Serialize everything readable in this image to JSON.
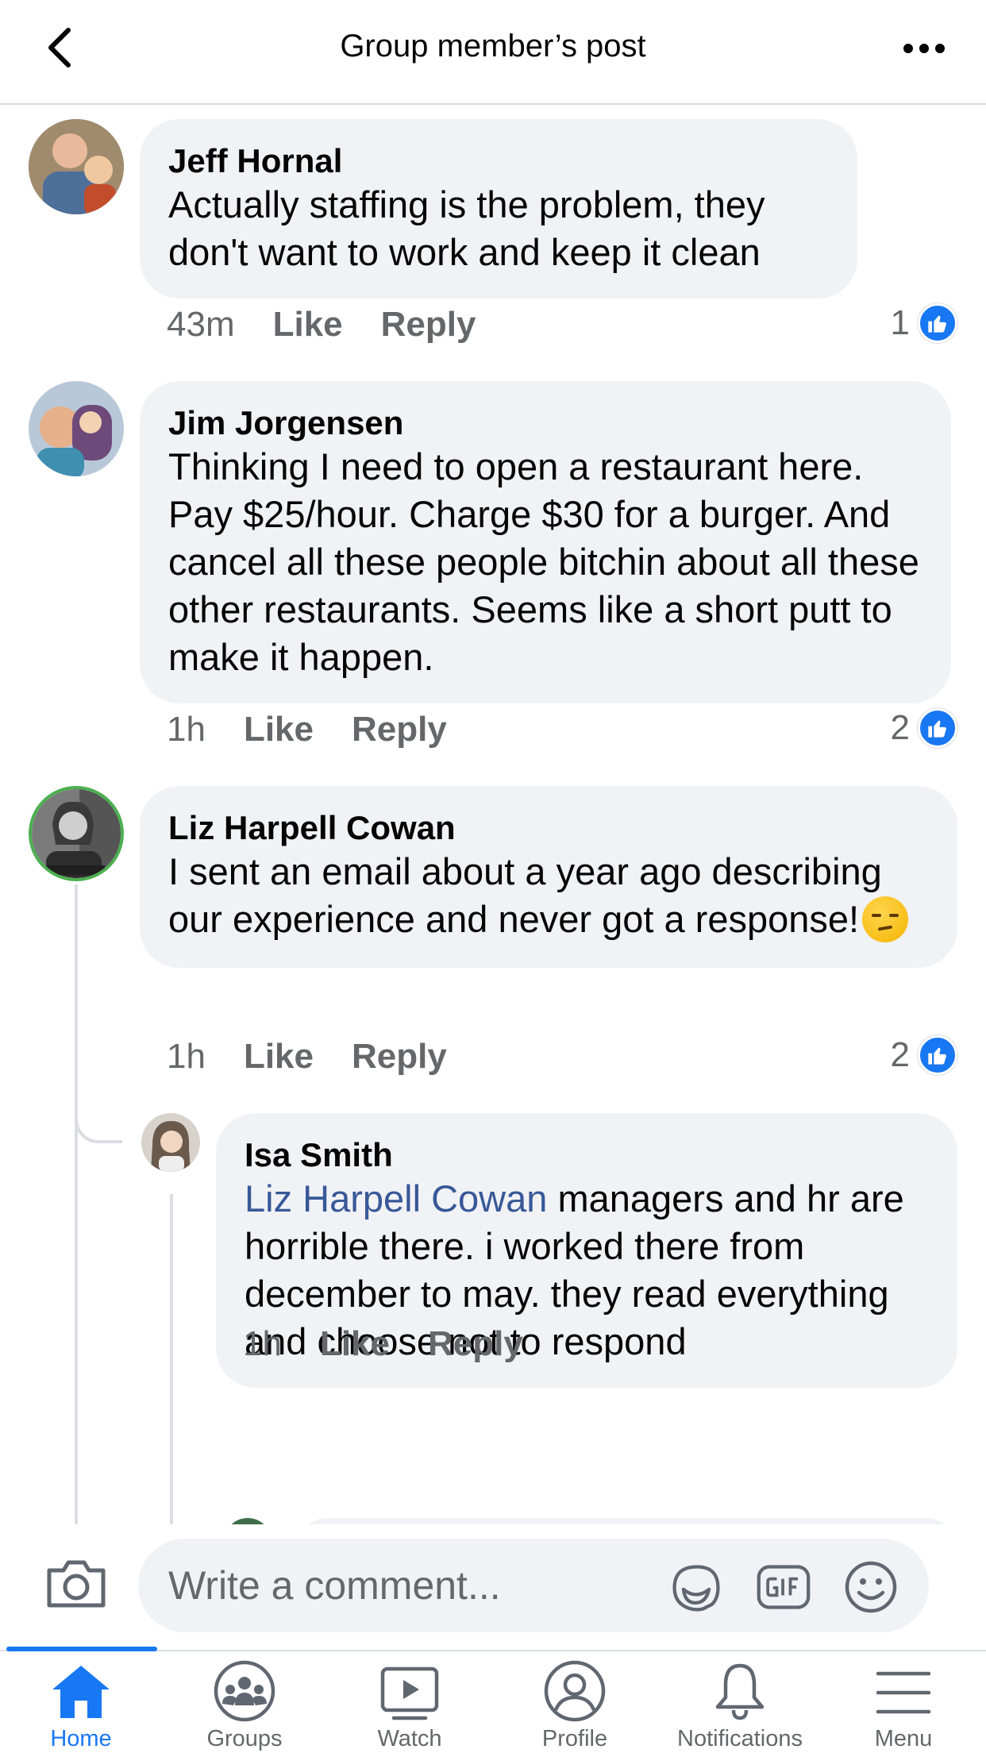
{
  "header": {
    "title": "Group member’s post"
  },
  "comments": [
    {
      "author": "Jeff Hornal",
      "text": "Actually staffing is the problem, they don't want to work and keep it clean",
      "time": "43m",
      "like_label": "Like",
      "reply_label": "Reply",
      "reaction_count": "1"
    },
    {
      "author": "Jim Jorgensen",
      "text": "Thinking I need to open a restaurant here. Pay $25/hour.   Charge $30 for a burger.  And cancel all these people bitchin about all these other restaurants.   Seems like a short putt to make it happen.",
      "time": "1h",
      "like_label": "Like",
      "reply_label": "Reply",
      "reaction_count": "2"
    },
    {
      "author": "Liz Harpell Cowan",
      "text": "I sent an email about a year ago describing our experience and never got a response!",
      "emoji": "unamused-face",
      "time": "1h",
      "like_label": "Like",
      "reply_label": "Reply",
      "reaction_count": "2",
      "replies": [
        {
          "author": "Isa Smith",
          "mention": "Liz Harpell Cowan",
          "text": " managers and hr are horrible there. i worked there from december to may. they read everything and choose not to respond",
          "time": "1h",
          "like_label": "Like",
          "reply_label": "Reply"
        }
      ]
    }
  ],
  "composer": {
    "placeholder": "Write a comment...",
    "icons": [
      "camera-icon",
      "sticker-icon",
      "gif-icon",
      "emoji-icon"
    ]
  },
  "bottom_nav": {
    "items": [
      {
        "label": "Home",
        "icon": "home-icon",
        "active": true
      },
      {
        "label": "Groups",
        "icon": "groups-icon"
      },
      {
        "label": "Watch",
        "icon": "watch-icon"
      },
      {
        "label": "Profile",
        "icon": "profile-icon"
      },
      {
        "label": "Notifications",
        "icon": "bell-icon"
      },
      {
        "label": "Menu",
        "icon": "menu-icon"
      }
    ]
  },
  "colors": {
    "accent": "#1877f2",
    "bubble": "#f0f2f5",
    "secondary_text": "#65676b",
    "mention": "#385898"
  }
}
